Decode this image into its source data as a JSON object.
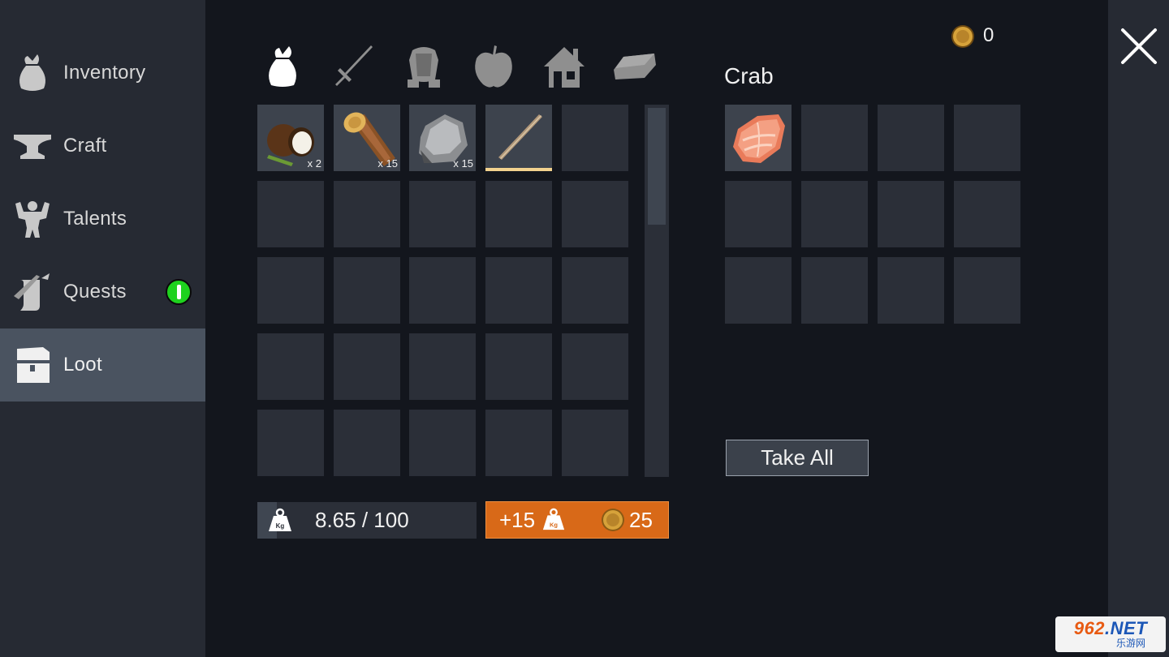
{
  "sidebar": {
    "items": [
      {
        "label": "Inventory",
        "icon": "bag-icon"
      },
      {
        "label": "Craft",
        "icon": "anvil-icon"
      },
      {
        "label": "Talents",
        "icon": "strongman-icon"
      },
      {
        "label": "Quests",
        "icon": "scroll-quill-icon",
        "badge": "!"
      },
      {
        "label": "Loot",
        "icon": "treasure-chest-icon",
        "active": true
      }
    ]
  },
  "categories": [
    "bag-icon",
    "sword-icon",
    "armor-icon",
    "apple-icon",
    "house-icon",
    "ingot-icon"
  ],
  "inventory": {
    "slots": [
      {
        "item": "coconut",
        "qty": "x 2"
      },
      {
        "item": "log",
        "qty": "x 15"
      },
      {
        "item": "stone",
        "qty": "x 15"
      },
      {
        "item": "stick",
        "qty": "",
        "selected": true
      }
    ],
    "weight": "8.65 / 100",
    "weight_fraction": 0.0865,
    "upgrade": {
      "plus": "+15",
      "cost": "25"
    }
  },
  "currency": {
    "coins": "0"
  },
  "loot": {
    "title": "Crab",
    "slots": [
      {
        "item": "raw-crab-meat"
      }
    ],
    "take_all_label": "Take All"
  },
  "colors": {
    "accent_orange": "#d86918",
    "badge_green": "#1ed21e",
    "selection_bar": "#f3d28e",
    "coin_gold": "#c8922a"
  },
  "watermark": {
    "main": "962",
    "net": ".NET",
    "sub": "乐游网"
  }
}
